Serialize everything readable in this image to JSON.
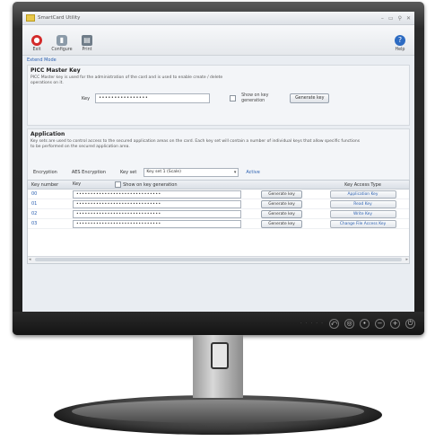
{
  "window": {
    "title": "SmartCard Utility",
    "controls": [
      "–",
      "▭",
      "⚲",
      "✕"
    ]
  },
  "toolbar": {
    "exit_label": "Exit",
    "configure_label": "Configure",
    "print_label": "Print",
    "help_label": "Help"
  },
  "mode_link": "Extend Mode",
  "picc": {
    "title": "PICC Master Key",
    "description": "PICC Master key is used for the administration of the card and is used to enable create / delete operations on it.",
    "key_label": "Key",
    "key_value": "••••••••••••••••",
    "show_label": "Show on key generation",
    "generate_label": "Generate key"
  },
  "application": {
    "title": "Application",
    "description": "Key sets are used to control access to the secured application areas on the card. Each key set will contain a number of individual keys that allow specific functions to be performed on the secured application area.",
    "encryption_label": "Encryption",
    "encryption_value": "AES Encryption",
    "keyset_label": "Key set",
    "keyset_value": "Key set 1 (Scale)",
    "active_label": "Active"
  },
  "grid": {
    "headers": {
      "num": "Key number",
      "key": "Key",
      "show": "Show on key generation",
      "type": "Key Access Type"
    },
    "rows": [
      {
        "num": "00",
        "key": "••••••••••••••••••••••••••••••",
        "gen": "Generate key",
        "type": "Application Key"
      },
      {
        "num": "01",
        "key": "••••••••••••••••••••••••••••••",
        "gen": "Generate key",
        "type": "Read Key"
      },
      {
        "num": "02",
        "key": "••••••••••••••••••••••••••••••",
        "gen": "Generate key",
        "type": "Write Key"
      },
      {
        "num": "03",
        "key": "••••••••••••••••••••••••••••••",
        "gen": "Generate key",
        "type": "Change File Access Key"
      }
    ]
  },
  "colors": {
    "accent": "#2a5fb0",
    "exit": "#d32a2a",
    "help": "#2d6bc2"
  }
}
